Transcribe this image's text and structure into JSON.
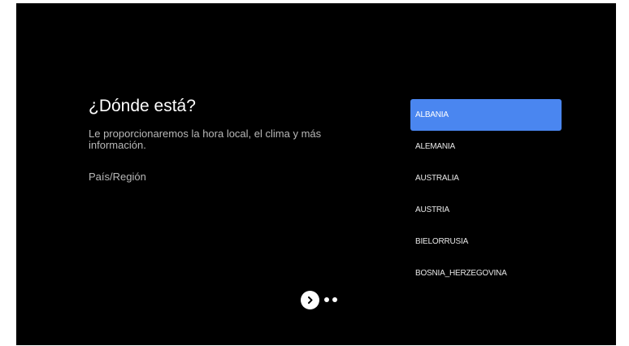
{
  "screen": {
    "title": "¿Dónde está?",
    "description": "Le proporcionaremos la hora local, el clima y más información.",
    "field_label": "País/Región"
  },
  "countries": {
    "selected_index": 0,
    "items": [
      {
        "label": "ALBANIA"
      },
      {
        "label": "ALEMANIA"
      },
      {
        "label": "AUSTRALIA"
      },
      {
        "label": "AUSTRIA"
      },
      {
        "label": "BIELORRUSIA"
      },
      {
        "label": "BOSNIA_HERZEGOVINA"
      }
    ]
  },
  "navigation": {
    "next_icon": "chevron-right-icon",
    "page_dots": 2
  },
  "colors": {
    "background": "#000000",
    "selection": "#4a86f0",
    "primary_text": "#ffffff",
    "secondary_text": "#b8b8b8"
  }
}
